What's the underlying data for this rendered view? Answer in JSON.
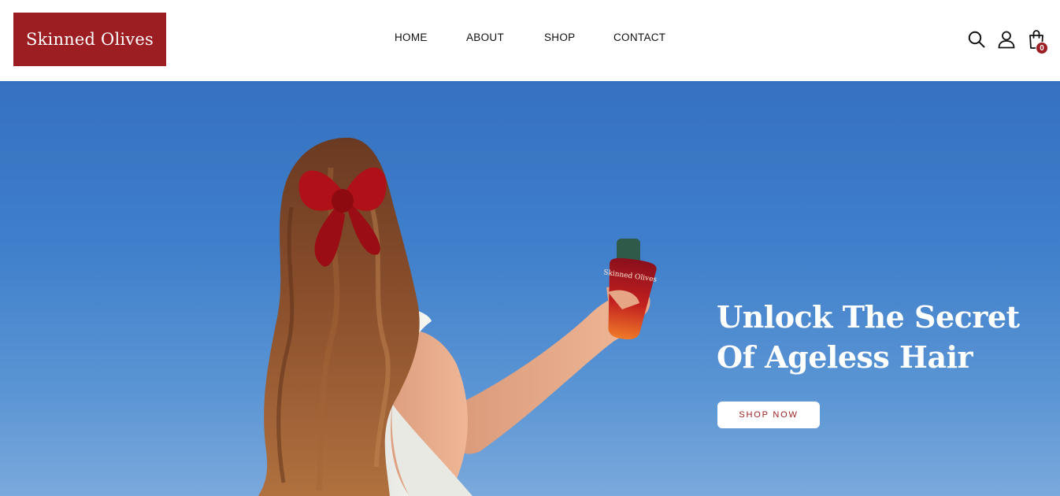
{
  "header": {
    "logo_text": "Skinned Olives",
    "nav": [
      {
        "label": "HOME"
      },
      {
        "label": "ABOUT"
      },
      {
        "label": "SHOP"
      },
      {
        "label": "CONTACT"
      }
    ],
    "icons": {
      "search": "search-icon",
      "account": "user-icon",
      "cart": "shopping-bag-icon"
    },
    "cart_count": "0"
  },
  "hero": {
    "heading_line1": "Unlock The Secret",
    "heading_line2": "Of Ageless Hair",
    "button_label": "SHOP NOW",
    "bottle_label": "Skinned Olives"
  },
  "colors": {
    "brand": "#9c1e22",
    "sky": "#3f7fcb",
    "white": "#ffffff"
  }
}
